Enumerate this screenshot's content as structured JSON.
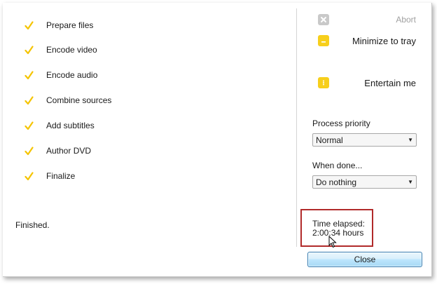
{
  "steps": [
    {
      "label": "Prepare files",
      "done": true
    },
    {
      "label": "Encode video",
      "done": true
    },
    {
      "label": "Encode audio",
      "done": true
    },
    {
      "label": "Combine sources",
      "done": true
    },
    {
      "label": "Add subtitles",
      "done": true
    },
    {
      "label": "Author DVD",
      "done": true
    },
    {
      "label": "Finalize",
      "done": true
    }
  ],
  "status": "Finished.",
  "actions": {
    "abort": {
      "label": "Abort",
      "icon": "close-icon",
      "enabled": false
    },
    "minimize": {
      "label": "Minimize to tray",
      "icon": "minimize-icon"
    },
    "entertain": {
      "label": "Entertain me",
      "icon": "dots-icon"
    }
  },
  "process_priority": {
    "label": "Process priority",
    "value": "Normal"
  },
  "when_done": {
    "label": "When done...",
    "value": "Do nothing"
  },
  "elapsed": {
    "label": "Time elapsed:",
    "value": "2:00:34 hours"
  },
  "close_label": "Close",
  "colors": {
    "check": "#f5c400",
    "accent_button": "#f7cf1c",
    "highlight": "#b12a2a"
  }
}
